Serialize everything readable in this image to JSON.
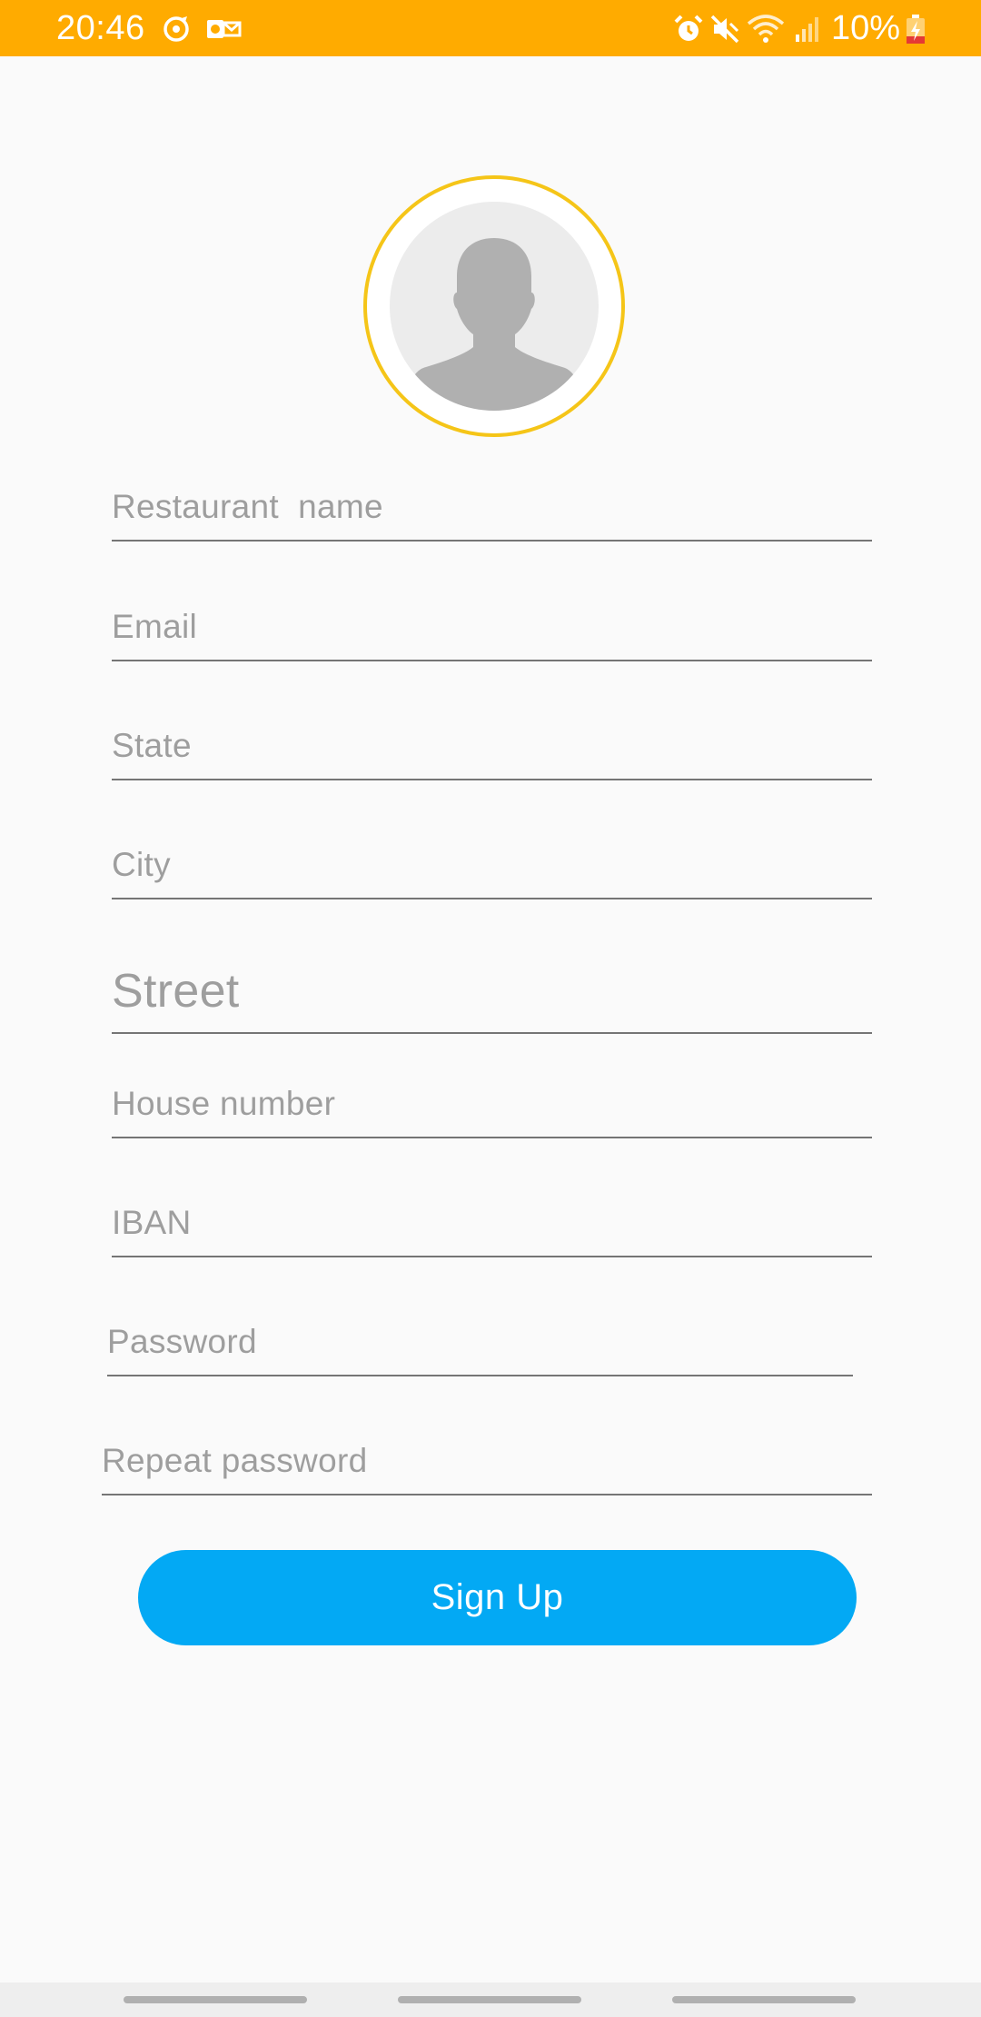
{
  "status_bar": {
    "time": "20:46",
    "battery_percent": "10%",
    "left_icons": [
      "sync-icon",
      "outlook-icon"
    ],
    "right_icons": [
      "alarm-icon",
      "mute-icon",
      "wifi-icon",
      "signal-icon",
      "battery-charging-icon"
    ],
    "color": "#ffab00"
  },
  "avatar": {
    "icon": "person-placeholder-icon",
    "ring_color": "#f5c518"
  },
  "form": {
    "restaurant_name": {
      "placeholder": "Restaurant  name",
      "value": ""
    },
    "email": {
      "placeholder": "Email",
      "value": ""
    },
    "state": {
      "placeholder": "State",
      "value": ""
    },
    "city": {
      "placeholder": "City",
      "value": ""
    },
    "street": {
      "placeholder": "Street",
      "value": ""
    },
    "house_number": {
      "placeholder": "House number",
      "value": ""
    },
    "iban": {
      "placeholder": "IBAN",
      "value": ""
    },
    "password": {
      "placeholder": "Password",
      "value": ""
    },
    "repeat_password": {
      "placeholder": "Repeat password",
      "value": ""
    }
  },
  "signup_button": {
    "label": "Sign Up",
    "color": "#03a9f4"
  }
}
